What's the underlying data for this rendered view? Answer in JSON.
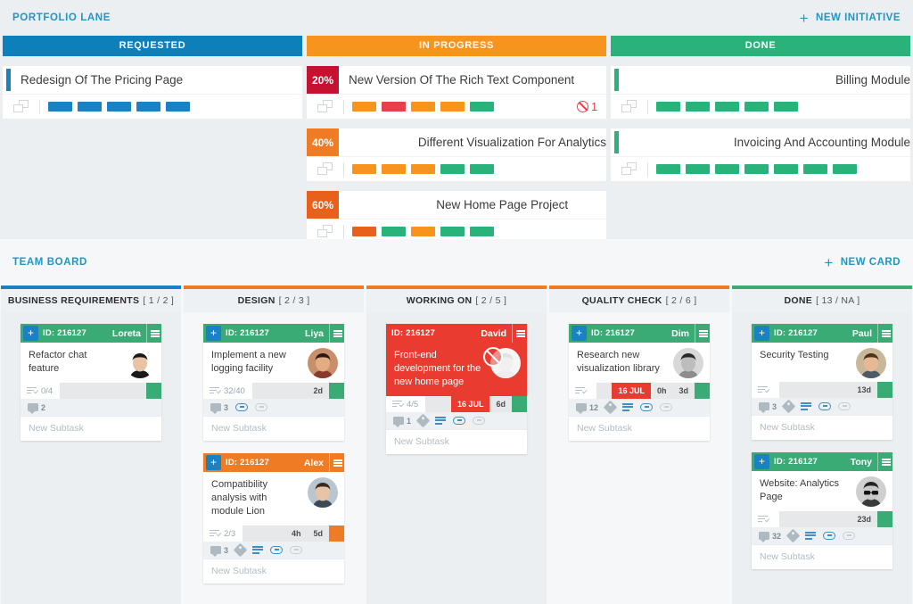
{
  "portfolio": {
    "title": "PORTFOLIO LANE",
    "new_label": "NEW INITIATIVE",
    "plus": "+",
    "columns": [
      {
        "name": "REQUESTED",
        "color": "#0d7fba",
        "cards": [
          {
            "name": "Redesign Of The Pricing Page",
            "percent": null,
            "accent": "#1a82c3",
            "fill_pct": 0,
            "fill_color": "#e3f1f8",
            "segments": [
              "#1a82c3",
              "#1a82c3",
              "#1a82c3",
              "#1a82c3",
              "#1a82c3"
            ],
            "blocked": null
          }
        ]
      },
      {
        "name": "IN PROGRESS",
        "color": "#f7941d",
        "cards": [
          {
            "name": "New Version Of The Rich Text Component",
            "percent": "20%",
            "badge_color": "#c41230",
            "fill_pct": 0,
            "fill_color": "#fdece9",
            "segments": [
              "#f7941d",
              "#e8404a",
              "#f7941d",
              "#f7941d",
              "#2ab27b"
            ],
            "blocked": "1"
          },
          {
            "name": "Different Visualization For Analytics",
            "percent": "40%",
            "badge_color": "#ef7c24",
            "fill_pct": 58,
            "fill_color": "#fbe3c7",
            "segments": [
              "#f7941d",
              "#f7941d",
              "#f7941d",
              "#2ab27b",
              "#2ab27b"
            ],
            "blocked": null
          },
          {
            "name": "New Home Page Project",
            "percent": "60%",
            "badge_color": "#e8601c",
            "fill_pct": 34,
            "fill_color": "#fbe3c7",
            "segments": [
              "#e8601c",
              "#2ab27b",
              "#f7941d",
              "#2ab27b",
              "#2ab27b"
            ],
            "blocked": null
          }
        ]
      },
      {
        "name": "DONE",
        "color": "#2ab27b",
        "cards": [
          {
            "name": "Billing Module",
            "percent": null,
            "accent": "#2ab27b",
            "fill_pct": 100,
            "fill_color": "#dff2e9",
            "segments": [
              "#2ab27b",
              "#2ab27b",
              "#2ab27b",
              "#2ab27b",
              "#2ab27b"
            ],
            "blocked": null
          },
          {
            "name": "Invoicing And Accounting Module",
            "percent": null,
            "accent": "#2ab27b",
            "fill_pct": 100,
            "fill_color": "#dff2e9",
            "segments": [
              "#2ab27b",
              "#2ab27b",
              "#2ab27b",
              "#2ab27b",
              "#2ab27b",
              "#2ab27b",
              "#2ab27b"
            ],
            "blocked": null
          }
        ]
      }
    ]
  },
  "team_board": {
    "title": "TEAM BOARD",
    "new_label": "NEW CARD",
    "plus": "+",
    "new_subtask_label": "New Subtask",
    "columns": [
      {
        "name": "BUSINESS REQUIREMENTS",
        "count": "[ 1 / 2 ]",
        "rule": "blue",
        "cards": [
          {
            "id": "ID: 216127",
            "user": "Loreta",
            "header_color": "green",
            "has_plus": true,
            "title": "Refactor chat feature",
            "body_red": false,
            "blocked": false,
            "avatar": "woman-dark-hair",
            "frac": "0/4",
            "date": null,
            "times": [],
            "end_color": "green",
            "comments": "2",
            "has_tag": false,
            "has_desc": false,
            "has_link": false,
            "has_attach": false,
            "second_row_style": "count-only"
          }
        ]
      },
      {
        "name": "DESIGN",
        "count": "[ 2 / 3 ]",
        "rule": "orange",
        "cards": [
          {
            "id": "ID: 216127",
            "user": "Liya",
            "header_color": "green",
            "has_plus": true,
            "title": "Implement a new logging facility",
            "body_red": false,
            "blocked": false,
            "avatar": "woman-curly",
            "frac": "32/40",
            "date": null,
            "times": [
              "2d"
            ],
            "end_color": "green",
            "comments": "3",
            "has_tag": false,
            "has_desc": false,
            "has_link": true,
            "has_attach": true,
            "second_row_style": "full"
          },
          {
            "id": "ID: 216127",
            "user": "Alex",
            "header_color": "orange",
            "has_plus": true,
            "title": "Compatibility analysis with module Lion",
            "body_red": false,
            "blocked": false,
            "avatar": "man-young",
            "frac": "2/3",
            "date": null,
            "times": [
              "4h",
              "5d"
            ],
            "end_color": "orange",
            "comments": "3",
            "has_tag": true,
            "has_desc": true,
            "has_link": true,
            "has_attach": true,
            "second_row_style": "full"
          }
        ]
      },
      {
        "name": "WORKING ON",
        "count": "[ 2 / 5 ]",
        "rule": "orange",
        "cards": [
          {
            "id": "ID: 216127",
            "user": "David",
            "header_color": "red",
            "has_plus": false,
            "title": "Front-end development for the new home page",
            "body_red": true,
            "blocked": true,
            "avatar": "man-blocked",
            "frac": "4/5",
            "date": "16 JUL",
            "times": [
              "6d"
            ],
            "end_color": "green",
            "comments": "1",
            "has_tag": true,
            "has_desc": true,
            "has_link": true,
            "has_attach": true,
            "second_row_style": "full"
          }
        ]
      },
      {
        "name": "QUALITY CHECK",
        "count": "[ 2 / 6 ]",
        "rule": "orange",
        "cards": [
          {
            "id": "ID: 216127",
            "user": "Dim",
            "header_color": "green",
            "has_plus": true,
            "title": "Research new visualization library",
            "body_red": false,
            "blocked": false,
            "avatar": "man-grey",
            "frac": "",
            "date": "16 JUL",
            "times": [
              "0h",
              "3d"
            ],
            "end_color": "green",
            "comments": "12",
            "has_tag": true,
            "has_desc": true,
            "has_link": true,
            "has_attach": true,
            "second_row_style": "full"
          }
        ]
      },
      {
        "name": "DONE",
        "count": "[ 13 / NA ]",
        "rule": "green",
        "cards": [
          {
            "id": "ID: 216127",
            "user": "Paul",
            "header_color": "green",
            "has_plus": true,
            "title": "Security Testing",
            "body_red": false,
            "blocked": false,
            "avatar": "man-smiling",
            "frac": "",
            "date": null,
            "times": [
              "13d"
            ],
            "end_color": "green",
            "comments": "3",
            "has_tag": true,
            "has_desc": true,
            "has_link": true,
            "has_attach": true,
            "second_row_style": "full"
          },
          {
            "id": "ID: 216127",
            "user": "Tony",
            "header_color": "green",
            "has_plus": true,
            "title": "Website: Analytics Page",
            "body_red": false,
            "blocked": false,
            "avatar": "man-sunglasses",
            "frac": "",
            "date": null,
            "times": [
              "23d"
            ],
            "end_color": "green",
            "comments": "32",
            "has_tag": true,
            "has_desc": true,
            "has_link": true,
            "has_attach": true,
            "second_row_style": "full"
          }
        ]
      }
    ]
  }
}
